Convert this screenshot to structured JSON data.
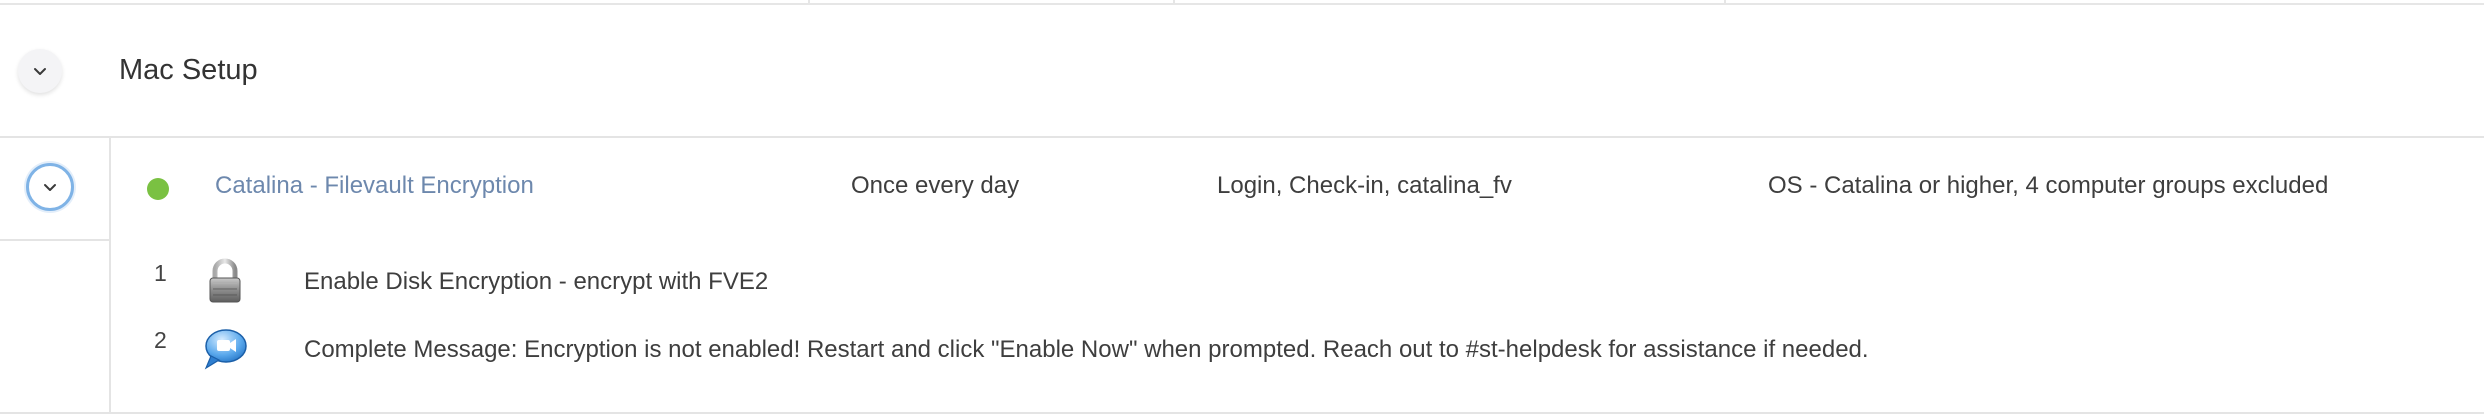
{
  "group": {
    "title": "Mac Setup",
    "toggle_icon": "chevron-down-icon"
  },
  "policy": {
    "toggle_icon": "chevron-down-icon",
    "status": {
      "state": "enabled",
      "color": "#7ac142"
    },
    "name": "Catalina - Filevault Encryption",
    "frequency": "Once every day",
    "triggers": "Login, Check-in, catalina_fv",
    "scope": "OS - Catalina or higher, 4 computer groups excluded",
    "steps": [
      {
        "number": "1",
        "icon": "lock-icon",
        "text": "Enable Disk Encryption - encrypt with FVE2"
      },
      {
        "number": "2",
        "icon": "message-bubble-icon",
        "text": "Complete Message: Encryption is not enabled! Restart and click \"Enable Now\" when prompted. Reach out to #st-helpdesk for assistance if needed."
      }
    ]
  },
  "colors": {
    "link": "#6d88ad",
    "toggle_active_border": "#7fb3e6",
    "divider": "#e4e4e4"
  }
}
